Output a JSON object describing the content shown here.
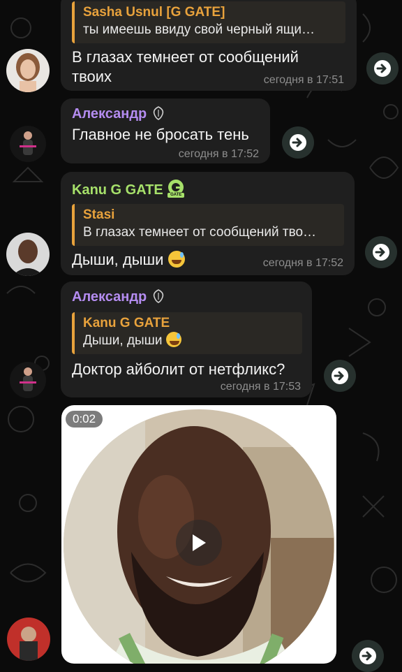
{
  "messages": [
    {
      "sender": "",
      "reply": {
        "name": "Sasha Usnul [G GATE]",
        "text": "ты имеешь ввиду свой черный ящи…"
      },
      "text_lines": [
        "В глазах темнеет от сообщений",
        "твоих"
      ],
      "time": "сегодня в 17:51"
    },
    {
      "sender": "Александр",
      "text": "Главное не бросать тень",
      "time": "сегодня в 17:52"
    },
    {
      "sender": "Kanu G GATE",
      "badge": "GATE",
      "reply": {
        "name": "Stasi",
        "text": "В глазах темнеет от сообщений тво…"
      },
      "text": "Дыши, дыши",
      "time": "сегодня в 17:52"
    },
    {
      "sender": "Александр",
      "reply": {
        "name": "Kanu G GATE",
        "text": "Дыши, дыши"
      },
      "text": "Доктор айболит от нетфликс?",
      "time": "сегодня в 17:53"
    }
  ],
  "video_note": {
    "duration": "0:02"
  },
  "colors": {
    "name_purple": "#b48cf0",
    "name_green": "#a6e06a",
    "reply_accent": "#e8a23c",
    "bubble": "#1f1f1f",
    "background": "#0b0b0b"
  },
  "icons": [
    "share-arrow-icon",
    "play-icon",
    "verified-badge-icon"
  ]
}
